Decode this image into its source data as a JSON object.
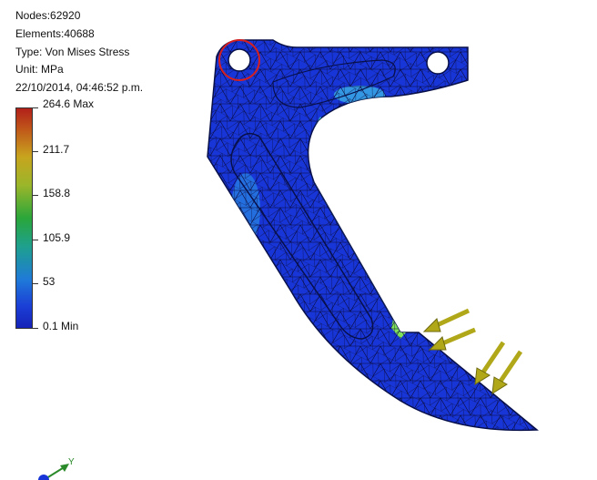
{
  "info": {
    "nodes": "Nodes:62920",
    "elements": "Elements:40688",
    "type": "Type: Von Mises Stress",
    "unit": "Unit: MPa",
    "timestamp": "22/10/2014, 04:46:52 p.m."
  },
  "legend": {
    "labels": [
      "264.6 Max",
      "211.7",
      "158.8",
      "105.9",
      "53",
      "0.1 Min"
    ]
  },
  "colors": {
    "part_base": "#1836d8",
    "mesh_line": "#0a0a3a",
    "highlight_circle": "#d42020",
    "load_arrow": "#b0a818",
    "stress_cyan": "#3fe0c8",
    "stress_green": "#7fe05a"
  },
  "triad": {
    "y_label": "Y"
  }
}
